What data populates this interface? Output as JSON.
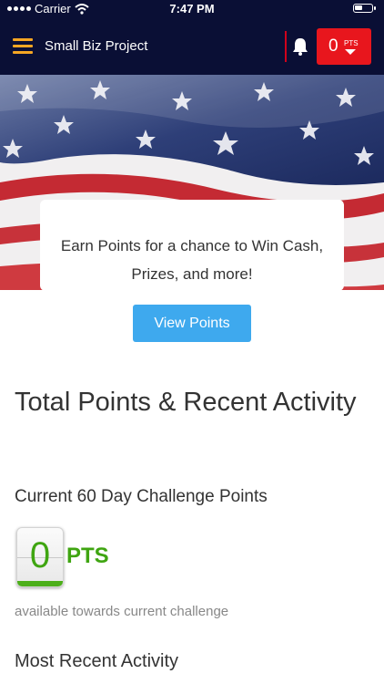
{
  "status_bar": {
    "carrier": "Carrier",
    "time": "7:47 PM"
  },
  "navbar": {
    "title": "Small Biz Project",
    "points_value": "0",
    "points_label": "PTS"
  },
  "hero": {
    "card_text": "Earn Points for a chance to Win Cash, Prizes, and more!",
    "button_label": "View Points"
  },
  "main": {
    "total_heading": "Total Points & Recent Activity",
    "challenge_heading": "Current 60 Day Challenge Points",
    "challenge_points": "0",
    "challenge_points_label": "PTS",
    "available_text": "available towards current challenge",
    "recent_heading": "Most Recent Activity"
  },
  "colors": {
    "navbar": "#0a0f35",
    "accent_red": "#e8161d",
    "button_blue": "#3ea9ee",
    "points_green": "#3fa511",
    "menu_orange": "#f5a623"
  },
  "icons": [
    "menu-icon",
    "bell-icon",
    "chevron-down-icon",
    "wifi-icon",
    "battery-icon"
  ]
}
